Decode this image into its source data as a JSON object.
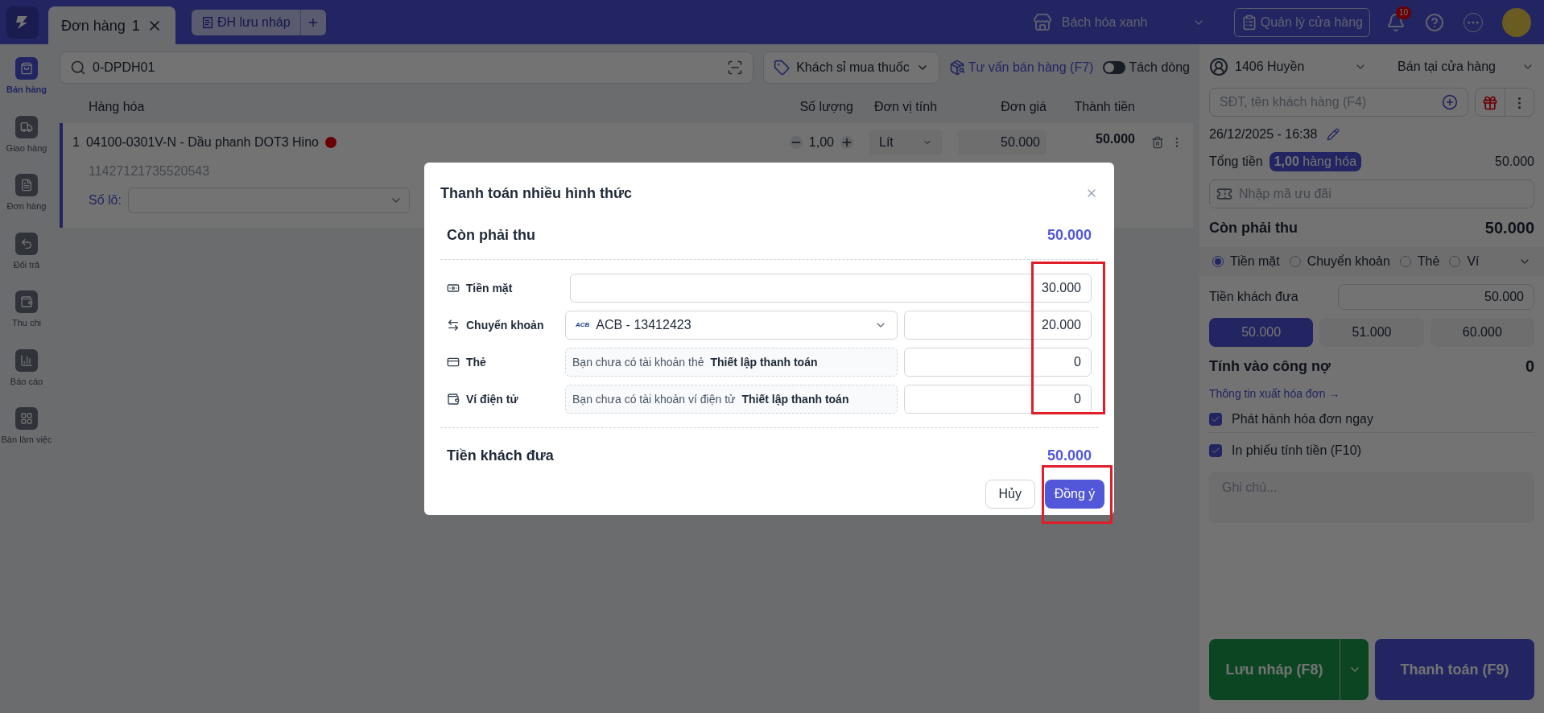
{
  "topbar": {
    "tabs": [
      {
        "label": "Đơn hàng",
        "count": "1",
        "selected": true
      }
    ],
    "draft_button": "ĐH lưu nháp",
    "store": "Bách hóa xanh",
    "manage_button": "Quản lý cửa hàng",
    "notification_count": "10"
  },
  "sidebar": {
    "items": [
      {
        "label": "Bán hàng",
        "selected": true
      },
      {
        "label": "Giao hàng",
        "selected": false
      },
      {
        "label": "Đơn hàng",
        "selected": false
      },
      {
        "label": "Đổi trả",
        "selected": false
      },
      {
        "label": "Thu chi",
        "selected": false
      },
      {
        "label": "Báo cáo",
        "selected": false
      },
      {
        "label": "Bàn làm việc",
        "selected": false
      }
    ]
  },
  "toolbar": {
    "search_value": "0-DPDH01",
    "price_list": "Khách sỉ mua thuốc",
    "advice_link": "Tư vấn bán hàng (F7)",
    "split_toggle": {
      "label": "Tách dòng",
      "on": false
    }
  },
  "table": {
    "columns": [
      "Hàng hóa",
      "Số lượng",
      "Đơn vị tính",
      "Đơn giá",
      "Thành tiền"
    ],
    "rows": [
      {
        "index": "1",
        "name": "04100-0301V-N - Dầu phanh DOT3 Hino",
        "code": "11427121735520543",
        "lot_label": "Số lô:",
        "quantity": "1,00",
        "unit": "Lít",
        "price": "50.000",
        "total": "50.000"
      }
    ]
  },
  "dialog": {
    "title": "Thanh toán nhiều hình thức",
    "due_label": "Còn phải thu",
    "due_value": "50.000",
    "methods": [
      {
        "kind": "cash",
        "label": "Tiền mặt",
        "amount": "30.000"
      },
      {
        "kind": "bank",
        "label": "Chuyển khoản",
        "bank_logo": "ACB",
        "account": "ACB - 13412423",
        "amount": "20.000"
      },
      {
        "kind": "card",
        "label": "Thẻ",
        "notice": "Bạn chưa có tài khoản thẻ",
        "setup_link": "Thiết lập thanh toán",
        "amount": "0"
      },
      {
        "kind": "wallet",
        "label": "Ví điện tử",
        "notice": "Bạn chưa có tài khoản ví điện tử",
        "setup_link": "Thiết lập thanh toán",
        "amount": "0"
      }
    ],
    "paid_label": "Tiền khách đưa",
    "paid_value": "50.000",
    "cancel_button": "Hủy",
    "confirm_button": "Đồng ý"
  },
  "order": {
    "staff": "1406 Huyền",
    "channel": "Bán tại cửa hàng",
    "customer_placeholder": "SĐT, tên khách hàng (F4)",
    "datetime": "26/12/2025 - 16:38",
    "total_label": "Tổng tiền",
    "items_count": "1,00",
    "items_label": "hàng hóa",
    "total_value": "50.000",
    "promo_placeholder": "Nhập mã ưu đãi",
    "due_label": "Còn phải thu",
    "due_value": "50.000",
    "payment_options": [
      {
        "label": "Tiền mặt",
        "selected": true
      },
      {
        "label": "Chuyển khoản",
        "selected": false
      },
      {
        "label": "Thẻ",
        "selected": false
      },
      {
        "label": "Ví",
        "selected": false
      }
    ],
    "paid_label": "Tiền khách đưa",
    "paid_value": "50.000",
    "quick_amounts": [
      {
        "label": "50.000",
        "selected": true
      },
      {
        "label": "51.000",
        "selected": false
      },
      {
        "label": "60.000",
        "selected": false
      }
    ],
    "debt_label": "Tính vào công nợ",
    "debt_value": "0",
    "invoice_link": "Thông tin xuất hóa đơn →",
    "options": [
      {
        "label": "Phát hành hóa đơn ngay",
        "checked": true
      },
      {
        "label": "In phiếu tính tiền (F10)",
        "checked": true
      }
    ],
    "note_placeholder": "Ghi chú...",
    "draft_button": "Lưu nháp (F8)",
    "pay_button": "Thanh toán (F9)"
  }
}
